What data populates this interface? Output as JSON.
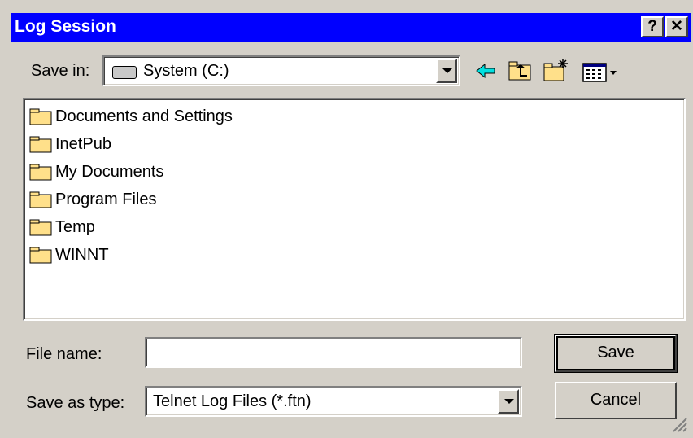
{
  "window": {
    "title": "Log Session",
    "help_glyph": "?",
    "close_glyph": "✕"
  },
  "save_in": {
    "label": "Save in:",
    "value": "System (C:)"
  },
  "folders": [
    {
      "label": "Documents and Settings"
    },
    {
      "label": "InetPub"
    },
    {
      "label": "My Documents"
    },
    {
      "label": "Program Files"
    },
    {
      "label": "Temp"
    },
    {
      "label": "WINNT"
    }
  ],
  "file_name": {
    "label": "File name:",
    "value": ""
  },
  "save_as_type": {
    "label": "Save as type:",
    "value": "Telnet Log Files (*.ftn)"
  },
  "buttons": {
    "save": "Save",
    "cancel": "Cancel"
  },
  "toolbar_icons": [
    "back-arrow-icon",
    "up-one-level-icon",
    "create-new-folder-icon",
    "view-menu-icon"
  ],
  "colors": {
    "titlebar": "#0000ff",
    "face": "#d4d0c8",
    "folder": "#ffe08a"
  }
}
